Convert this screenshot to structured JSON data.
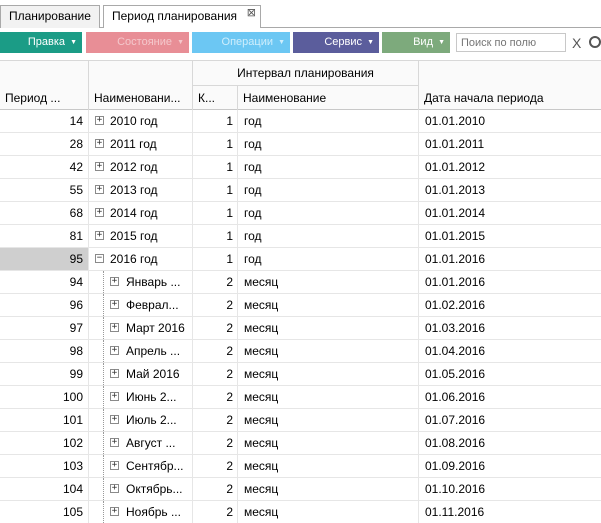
{
  "tabs": [
    {
      "label": "Планирование",
      "active": false
    },
    {
      "label": "Период планирования",
      "active": true
    }
  ],
  "toolbar": {
    "buttons": [
      {
        "label": "Правка",
        "color": "#1b9c86",
        "enabled": true
      },
      {
        "label": "Состояние",
        "color": "#e88e96",
        "enabled": false
      },
      {
        "label": "Операции",
        "color": "#6cc7f3",
        "enabled": false
      },
      {
        "label": "Сервис",
        "color": "#5b5d9c",
        "enabled": true
      },
      {
        "label": "Вид",
        "color": "#7daa7c",
        "enabled": true
      }
    ],
    "search_placeholder": "Поиск по полю",
    "clear_label": "X"
  },
  "grid": {
    "group_header": "Интервал планирования",
    "columns": [
      "Период ...",
      "Наименовани...",
      "К...",
      "Наименование",
      "Дата начала периода"
    ],
    "rows": [
      {
        "period": "14",
        "name": "2010 год",
        "level": 0,
        "expander": "+",
        "k": "1",
        "interval": "год",
        "date": "01.01.2010"
      },
      {
        "period": "28",
        "name": "2011 год",
        "level": 0,
        "expander": "+",
        "k": "1",
        "interval": "год",
        "date": "01.01.2011"
      },
      {
        "period": "42",
        "name": "2012 год",
        "level": 0,
        "expander": "+",
        "k": "1",
        "interval": "год",
        "date": "01.01.2012"
      },
      {
        "period": "55",
        "name": "2013 год",
        "level": 0,
        "expander": "+",
        "k": "1",
        "interval": "год",
        "date": "01.01.2013"
      },
      {
        "period": "68",
        "name": "2014 год",
        "level": 0,
        "expander": "+",
        "k": "1",
        "interval": "год",
        "date": "01.01.2014"
      },
      {
        "period": "81",
        "name": "2015 год",
        "level": 0,
        "expander": "+",
        "k": "1",
        "interval": "год",
        "date": "01.01.2015"
      },
      {
        "period": "95",
        "name": "2016 год",
        "level": 0,
        "expander": "−",
        "k": "1",
        "interval": "год",
        "date": "01.01.2016",
        "selected": true
      },
      {
        "period": "94",
        "name": "Январь ...",
        "level": 1,
        "expander": "+",
        "k": "2",
        "interval": "месяц",
        "date": "01.01.2016"
      },
      {
        "period": "96",
        "name": "Феврал...",
        "level": 1,
        "expander": "+",
        "k": "2",
        "interval": "месяц",
        "date": "01.02.2016"
      },
      {
        "period": "97",
        "name": "Март 2016",
        "level": 1,
        "expander": "+",
        "k": "2",
        "interval": "месяц",
        "date": "01.03.2016"
      },
      {
        "period": "98",
        "name": "Апрель ...",
        "level": 1,
        "expander": "+",
        "k": "2",
        "interval": "месяц",
        "date": "01.04.2016"
      },
      {
        "period": "99",
        "name": "Май 2016",
        "level": 1,
        "expander": "+",
        "k": "2",
        "interval": "месяц",
        "date": "01.05.2016"
      },
      {
        "period": "100",
        "name": "Июнь 2...",
        "level": 1,
        "expander": "+",
        "k": "2",
        "interval": "месяц",
        "date": "01.06.2016"
      },
      {
        "period": "101",
        "name": "Июль 2...",
        "level": 1,
        "expander": "+",
        "k": "2",
        "interval": "месяц",
        "date": "01.07.2016"
      },
      {
        "period": "102",
        "name": "Август ...",
        "level": 1,
        "expander": "+",
        "k": "2",
        "interval": "месяц",
        "date": "01.08.2016"
      },
      {
        "period": "103",
        "name": "Сентябр...",
        "level": 1,
        "expander": "+",
        "k": "2",
        "interval": "месяц",
        "date": "01.09.2016"
      },
      {
        "period": "104",
        "name": "Октябрь...",
        "level": 1,
        "expander": "+",
        "k": "2",
        "interval": "месяц",
        "date": "01.10.2016"
      },
      {
        "period": "105",
        "name": "Ноябрь ...",
        "level": 1,
        "expander": "+",
        "k": "2",
        "interval": "месяц",
        "date": "01.11.2016"
      }
    ]
  }
}
